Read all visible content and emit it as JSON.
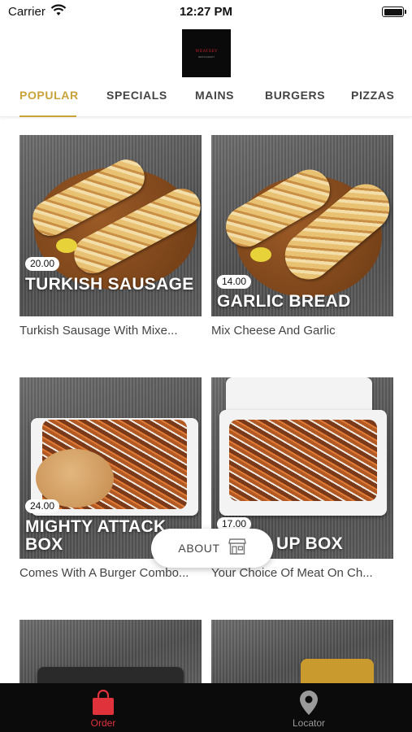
{
  "status_bar": {
    "carrier": "Carrier",
    "time": "12:27 PM"
  },
  "logo": {
    "name": "WEATSEY",
    "sub": "RESTAURANT"
  },
  "tabs": [
    {
      "label": "POPULAR",
      "active": true
    },
    {
      "label": "SPECIALS",
      "active": false
    },
    {
      "label": "MAINS",
      "active": false
    },
    {
      "label": "BURGERS",
      "active": false
    },
    {
      "label": "PIZZAS",
      "active": false
    }
  ],
  "menu_items": [
    {
      "price": "20.00",
      "title": "TURKISH SAUSAGE",
      "description": "Turkish Sausage With Mixe..."
    },
    {
      "price": "14.00",
      "title": "GARLIC BREAD",
      "description": "Mix Cheese And Garlic"
    },
    {
      "price": "24.00",
      "title": "MIGHTY ATTACK BOX",
      "description": "Comes With A Burger Combo..."
    },
    {
      "price": "17.00",
      "title": "UP BOX",
      "description": "Your Choice Of Meat On Ch..."
    }
  ],
  "about_button": {
    "label": "ABOUT",
    "icon": "storefront-icon"
  },
  "bottom_nav": [
    {
      "label": "Order",
      "icon": "shopping-bag-icon",
      "active": true
    },
    {
      "label": "Locator",
      "icon": "location-pin-icon",
      "active": false
    }
  ],
  "colors": {
    "accent": "#c9a23a",
    "order_active": "#e0323b",
    "nav_bg": "#0b0b0b",
    "nav_inactive": "#9a9a9a"
  }
}
